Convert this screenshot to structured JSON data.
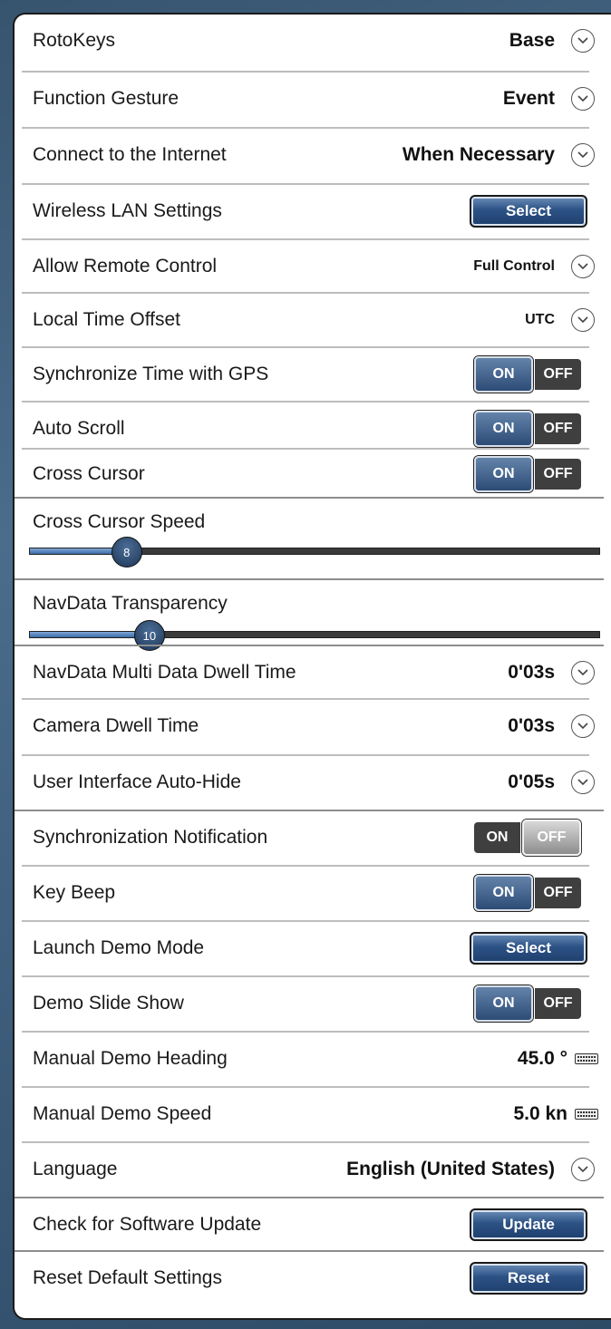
{
  "settings": [
    {
      "label": "RotoKeys",
      "value": "Base"
    },
    {
      "label": "Function Gesture",
      "value": "Event"
    },
    {
      "label": "Connect to the Internet",
      "value": "When Necessary"
    },
    {
      "label": "Wireless LAN Settings",
      "button": "Select"
    },
    {
      "label": "Allow Remote Control",
      "value": "Full Control"
    },
    {
      "label": "Local Time Offset",
      "value": "UTC"
    },
    {
      "label": "Synchronize Time with GPS",
      "on": "ON",
      "off": "OFF",
      "state": "ON"
    },
    {
      "label": "Auto Scroll",
      "on": "ON",
      "off": "OFF",
      "state": "ON"
    },
    {
      "label": "Cross Cursor",
      "on": "ON",
      "off": "OFF",
      "state": "ON"
    },
    {
      "label": "Cross Cursor Speed",
      "slider_value": "8",
      "slider_fraction": 0.17
    },
    {
      "label": "NavData Transparency",
      "slider_value": "10",
      "slider_fraction": 0.21
    },
    {
      "label": "NavData Multi Data Dwell Time",
      "value": "0'03s"
    },
    {
      "label": "Camera Dwell Time",
      "value": "0'03s"
    },
    {
      "label": "User Interface Auto-Hide",
      "value": "0'05s"
    },
    {
      "label": "Synchronization Notification",
      "on": "ON",
      "off": "OFF",
      "state": "OFF"
    },
    {
      "label": "Key Beep",
      "on": "ON",
      "off": "OFF",
      "state": "ON"
    },
    {
      "label": "Launch Demo Mode",
      "button": "Select"
    },
    {
      "label": "Demo Slide Show",
      "on": "ON",
      "off": "OFF",
      "state": "ON"
    },
    {
      "label": "Manual Demo Heading",
      "value": "45.0 °"
    },
    {
      "label": "Manual Demo Speed",
      "value": "5.0 kn"
    },
    {
      "label": "Language",
      "value": "English (United States)"
    },
    {
      "label": "Check for Software Update",
      "button": "Update"
    },
    {
      "label": "Reset Default Settings",
      "button": "Reset"
    }
  ],
  "icons": {
    "dropdown": "chevron-down-icon",
    "keyboard": "keyboard-icon"
  },
  "colors": {
    "accent": "#2c5285",
    "slider_fill": "#5b8cc6",
    "background": "#3f6180"
  }
}
